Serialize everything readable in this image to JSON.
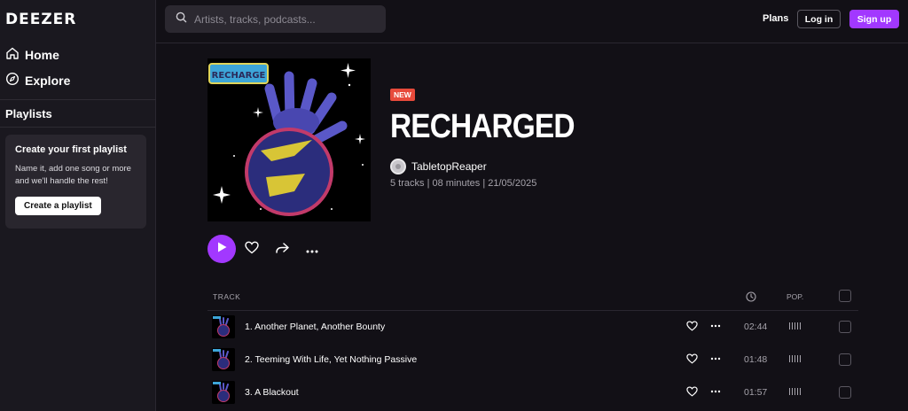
{
  "brand": {
    "logo": "DEEZER",
    "accent": "#a238ff",
    "new_badge_color": "#e74a3b"
  },
  "sidebar": {
    "nav": [
      {
        "label": "Home",
        "icon": "home-icon"
      },
      {
        "label": "Explore",
        "icon": "compass-icon"
      }
    ],
    "playlists_title": "Playlists",
    "card": {
      "title": "Create your first playlist",
      "text": "Name it, add one song or more and we'll handle the rest!",
      "button": "Create a playlist"
    }
  },
  "header": {
    "search_placeholder": "Artists, tracks, podcasts...",
    "plans": "Plans",
    "login": "Log in",
    "signup": "Sign up"
  },
  "album": {
    "cover_text": "RECHARGE",
    "badge": "NEW",
    "title": "RECHARGED",
    "artist": "TabletopReaper",
    "meta": "5 tracks | 08 minutes | 21/05/2025"
  },
  "table": {
    "col_track": "TRACK",
    "col_pop": "POP.",
    "tracks": [
      {
        "title": "1. Another Planet, Another Bounty",
        "duration": "02:44"
      },
      {
        "title": "2. Teeming With Life, Yet Nothing Passive",
        "duration": "01:48"
      },
      {
        "title": "3. A Blackout",
        "duration": "01:57"
      }
    ]
  }
}
